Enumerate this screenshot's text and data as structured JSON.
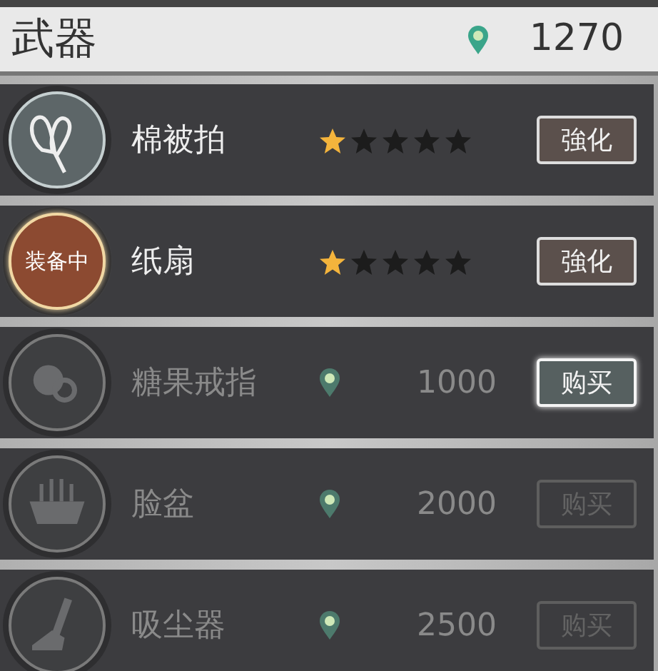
{
  "header": {
    "title": "武器",
    "currency": "1270"
  },
  "items": [
    {
      "kind": "owned",
      "name": "棉被拍",
      "equipped": false,
      "locked": false,
      "stars": 1,
      "button": {
        "label": "強化",
        "disabled": false
      }
    },
    {
      "kind": "owned",
      "name": "纸扇",
      "equipped": true,
      "badge": "装备中",
      "locked": false,
      "stars": 1,
      "button": {
        "label": "強化",
        "disabled": false
      }
    },
    {
      "kind": "shop",
      "name": "糖果戒指",
      "equipped": false,
      "locked": true,
      "price": "1000",
      "button": {
        "label": "购买",
        "disabled": false
      }
    },
    {
      "kind": "shop",
      "name": "脸盆",
      "equipped": false,
      "locked": true,
      "price": "2000",
      "button": {
        "label": "购买",
        "disabled": true
      }
    },
    {
      "kind": "shop",
      "name": "吸尘器",
      "equipped": false,
      "locked": true,
      "price": "2500",
      "button": {
        "label": "购买",
        "disabled": true
      }
    }
  ]
}
